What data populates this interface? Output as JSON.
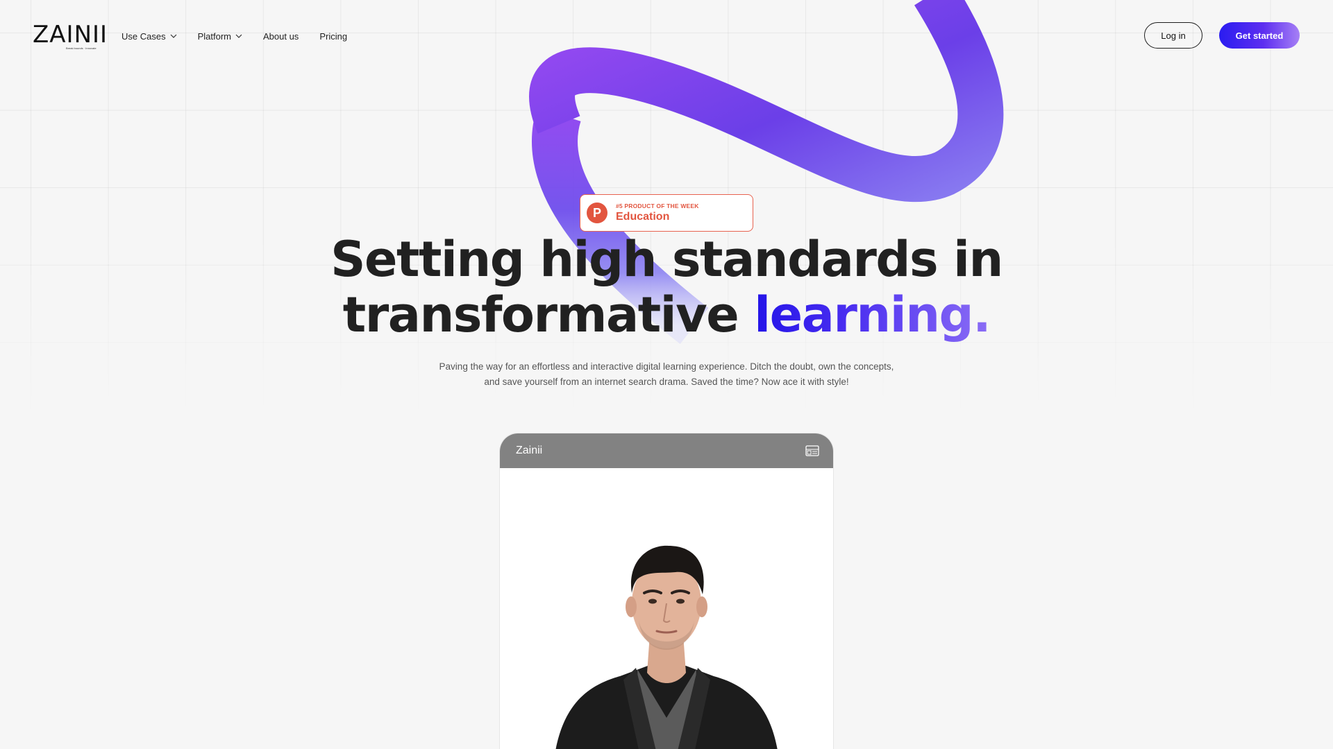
{
  "brand": {
    "name": "ZAINII",
    "tagline": "Break bounds · Innovate"
  },
  "nav": {
    "items": [
      {
        "label": "Use Cases",
        "has_dropdown": true
      },
      {
        "label": "Platform",
        "has_dropdown": true
      },
      {
        "label": "About us",
        "has_dropdown": false
      },
      {
        "label": "Pricing",
        "has_dropdown": false
      }
    ],
    "login_label": "Log in",
    "cta_label": "Get started"
  },
  "badge": {
    "kicker": "#5 PRODUCT OF THE WEEK",
    "title": "Education",
    "icon_letter": "P",
    "icon": "product-hunt-icon"
  },
  "hero": {
    "headline_line1": "Setting high standards in",
    "headline_line2_plain": "transformative",
    "headline_line2_accent": "learning.",
    "subcopy": "Paving the way for an effortless and interactive digital learning experience.  Ditch the doubt, own the concepts, and save yourself from an internet search drama. Saved the time? Now ace it with style!"
  },
  "preview": {
    "title": "Zainii",
    "toolbar_icon": "layout-icon"
  },
  "colors": {
    "accent_blue": "#2a1cf0",
    "accent_purple": "#8b6df5",
    "badge_red": "#e2553f",
    "preview_bar": "#828282",
    "background": "#f6f6f6"
  }
}
